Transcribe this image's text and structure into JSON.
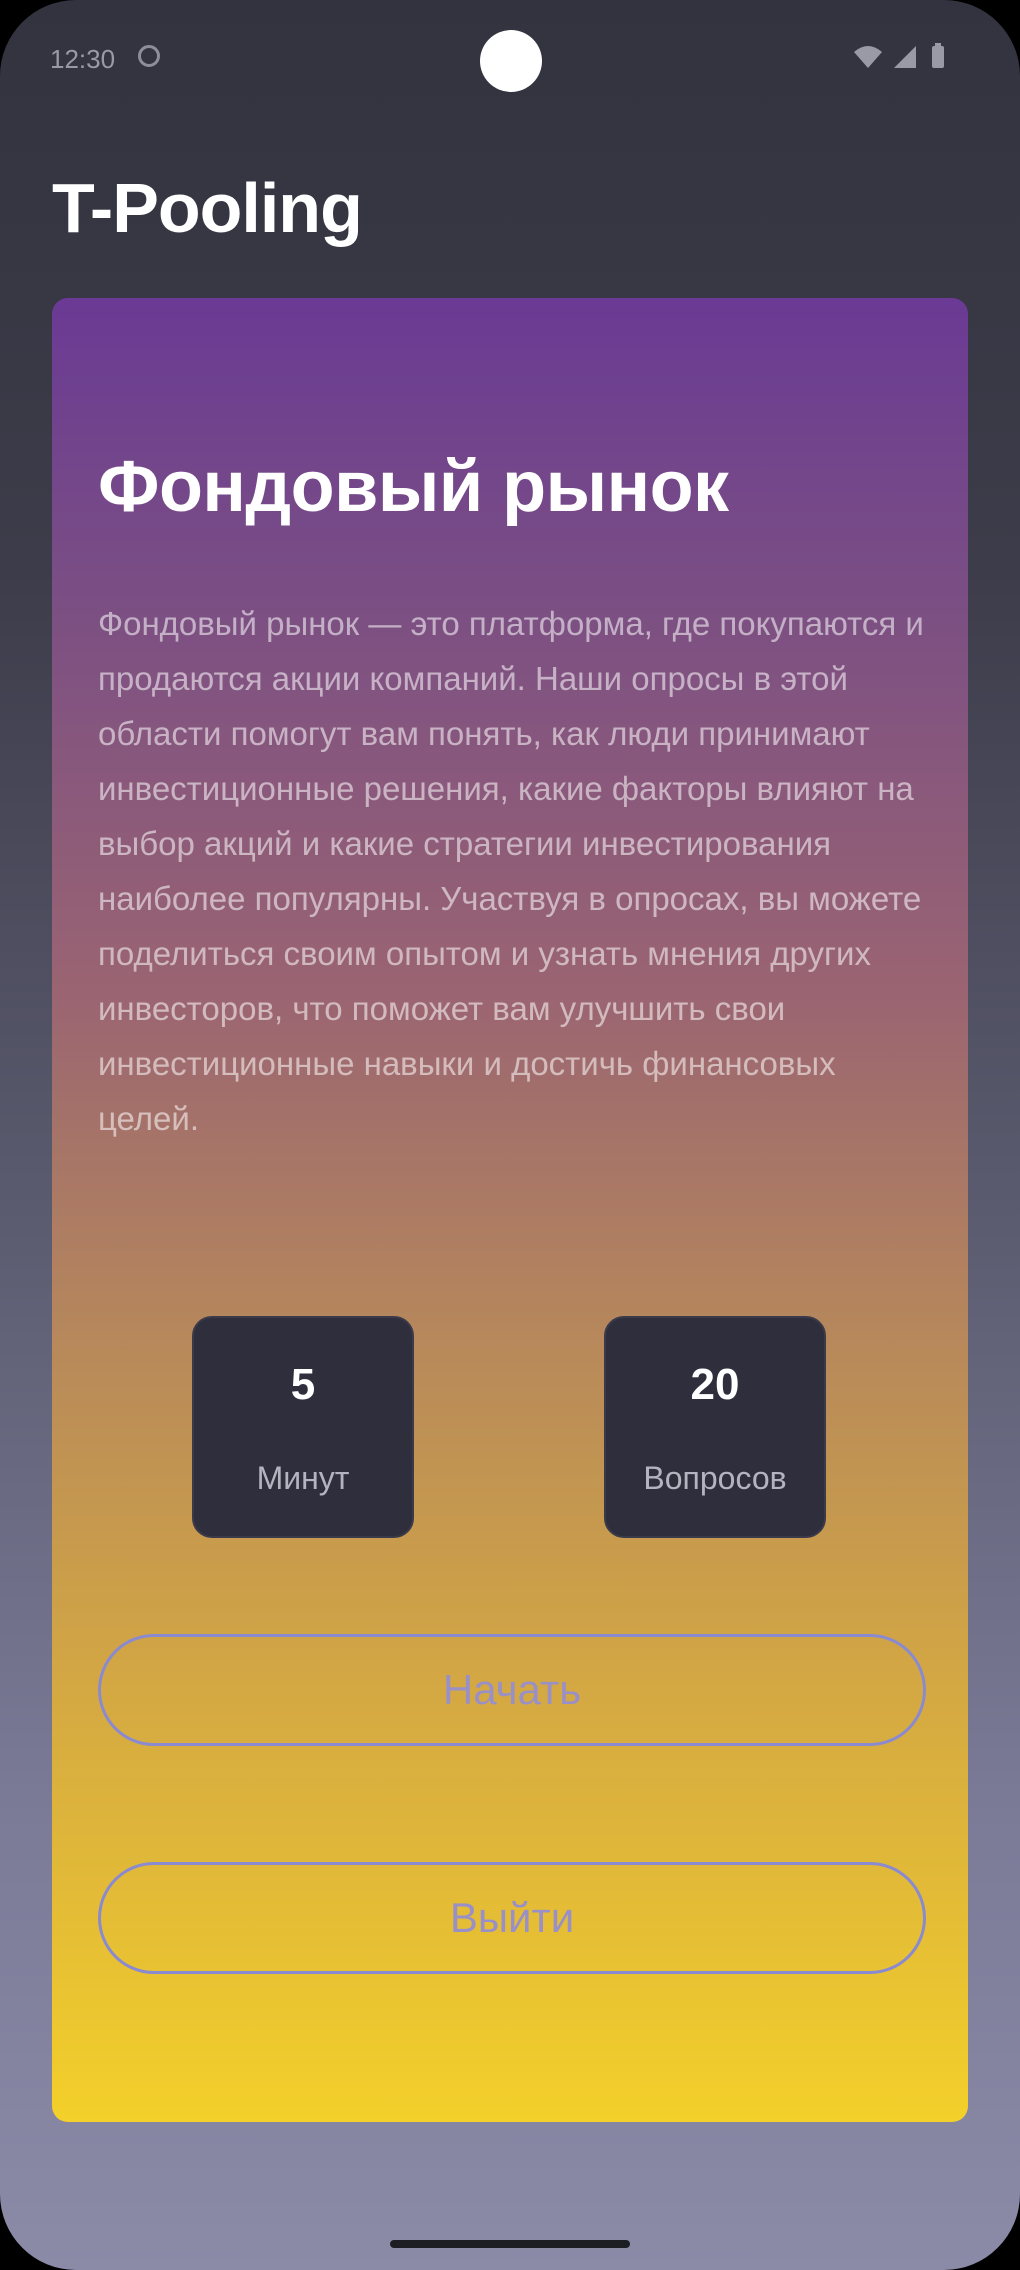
{
  "status_bar": {
    "time": "12:30",
    "icons": [
      "sync-icon",
      "wifi-icon",
      "signal-icon",
      "battery-icon"
    ]
  },
  "app": {
    "title": "T-Pooling"
  },
  "card": {
    "title": "Фондовый рынок",
    "description": "Фондовый рынок — это платформа, где покупаются и продаются акции компаний. Наши опросы в этой области помогут вам понять, как люди принимают инвестиционные решения, какие факторы влияют на выбор акций и какие стратегии инвестирования наиболее популярны. Участвуя в опросах, вы можете поделиться своим опытом и узнать мнения других инвесторов, что поможет вам улучшить свои инвестиционные навыки и достичь финансовых целей.",
    "stats": {
      "minutes": {
        "value": "5",
        "label": "Минут"
      },
      "questions": {
        "value": "20",
        "label": "Вопросов"
      }
    },
    "buttons": {
      "start": "Начать",
      "exit": "Выйти"
    }
  },
  "colors": {
    "card_top": "#6a3a94",
    "card_bottom": "#f4d02a",
    "button_border": "#8a8ad0",
    "stat_bg": "#2e2e3d"
  }
}
